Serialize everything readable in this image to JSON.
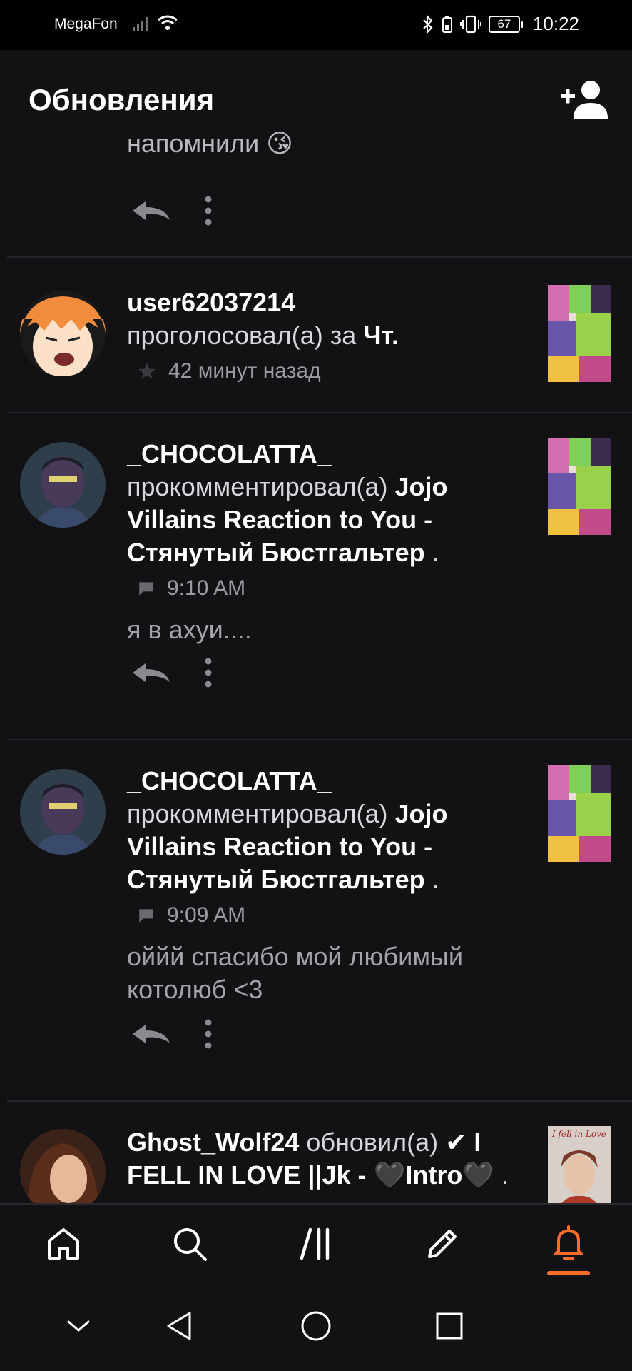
{
  "status_bar": {
    "carrier": "MegaFon",
    "battery": "67",
    "time": "10:22"
  },
  "header": {
    "title": "Обновления",
    "add_user_icon": "add-person-icon"
  },
  "colors": {
    "accent": "#ff6c2c",
    "background": "#121114",
    "text_primary": "#ffffff",
    "text_secondary": "#9a9aa0"
  },
  "partial_item": {
    "text": "напомнили 😘"
  },
  "items": [
    {
      "username": "user62037214",
      "verb": "проголосовал(а) за",
      "story": "Чт.",
      "meta_icon": "star-icon",
      "time": "42 минут назад"
    },
    {
      "username": "_CHOCOLATTA_",
      "verb": "прокомментировал(а)",
      "story": "Jojo Villains Reaction to You - Стянутый Бюстгальтер",
      "suffix": ".",
      "meta_icon": "comment-icon",
      "time": "9:10 AM",
      "comment": "я в ахуи...."
    },
    {
      "username": "_CHOCOLATTA_",
      "verb": "прокомментировал(а)",
      "story": "Jojo Villains Reaction to You - Стянутый Бюстгальтер",
      "suffix": ".",
      "meta_icon": "comment-icon",
      "time": "9:09 AM",
      "comment": "оййй спасибо мой любимый котолюб <3"
    },
    {
      "username": "Ghost_Wolf24",
      "verb": "обновил(а)",
      "story": "✔ I FELL IN LOVE ||Jk - 🖤Intro🖤",
      "suffix": ".",
      "thumb_text": "I fell in Love"
    }
  ],
  "bottom_nav": [
    {
      "name": "home",
      "icon": "home-icon",
      "active": false
    },
    {
      "name": "search",
      "icon": "search-icon",
      "active": false
    },
    {
      "name": "library",
      "icon": "library-icon",
      "active": false
    },
    {
      "name": "write",
      "icon": "pencil-icon",
      "active": false
    },
    {
      "name": "notifications",
      "icon": "bell-icon",
      "active": true
    }
  ],
  "system_nav": [
    "chevron-down-icon",
    "back-icon",
    "home-circle-icon",
    "recents-icon"
  ]
}
